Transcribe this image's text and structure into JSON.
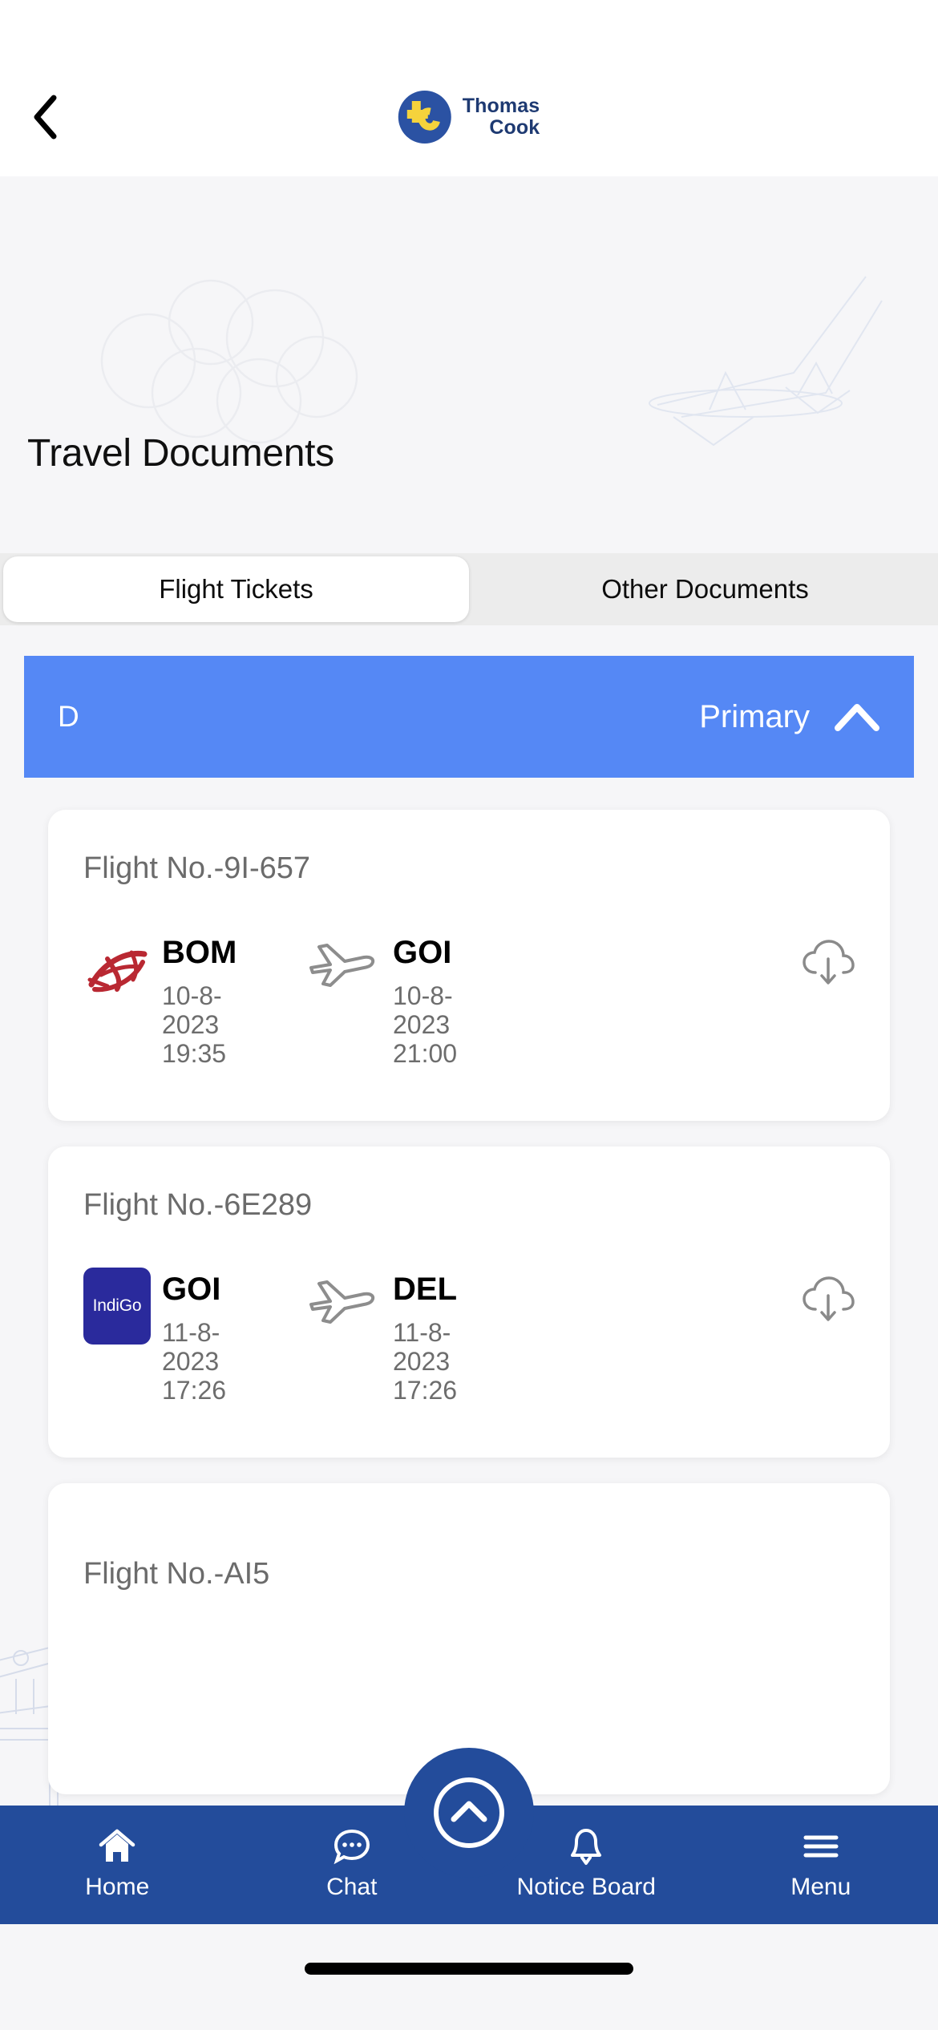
{
  "header": {
    "back_icon": "chevron-left-icon",
    "brand": {
      "line1": "Thomas",
      "line2": "Cook",
      "logo_icon": "thomas-cook-logo"
    }
  },
  "page": {
    "title": "Travel Documents"
  },
  "tabs": [
    {
      "label": "Flight Tickets",
      "active": true
    },
    {
      "label": "Other Documents",
      "active": false
    }
  ],
  "group_bar": {
    "letter": "D",
    "label": "Primary",
    "toggle_icon": "chevron-up-icon",
    "color": "#5588f5"
  },
  "flights": [
    {
      "flight_no": "Flight No.-9I-657",
      "airline": "air-india-express-logo",
      "origin": {
        "code": "BOM",
        "date_line1": "10-8-",
        "date_line2": "2023",
        "time": "19:35"
      },
      "destination": {
        "code": "GOI",
        "date_line1": "10-8-",
        "date_line2": "2023",
        "time": "21:00"
      },
      "download_icon": "cloud-download-icon"
    },
    {
      "flight_no": "Flight No.-6E289",
      "airline": "indigo-logo",
      "airline_label": "IndiGo",
      "origin": {
        "code": "GOI",
        "date_line1": "11-8-",
        "date_line2": "2023",
        "time": "17:26"
      },
      "destination": {
        "code": "DEL",
        "date_line1": "11-8-",
        "date_line2": "2023",
        "time": "17:26"
      },
      "download_icon": "cloud-download-icon"
    },
    {
      "flight_no": "Flight No.-AI5",
      "airline": "",
      "origin": {
        "code": "",
        "date_line1": "",
        "date_line2": "",
        "time": ""
      },
      "destination": {
        "code": "",
        "date_line1": "",
        "date_line2": "",
        "time": ""
      },
      "download_icon": ""
    }
  ],
  "fab": {
    "icon": "chevron-up-circle-icon",
    "color": "#234c9b"
  },
  "bottom_nav": {
    "color": "#234c9b",
    "items": [
      {
        "label": "Home",
        "icon": "home-icon"
      },
      {
        "label": "Chat",
        "icon": "chat-bubble-icon"
      },
      {
        "label": "Notice Board",
        "icon": "bell-icon"
      },
      {
        "label": "Menu",
        "icon": "hamburger-menu-icon"
      }
    ]
  }
}
